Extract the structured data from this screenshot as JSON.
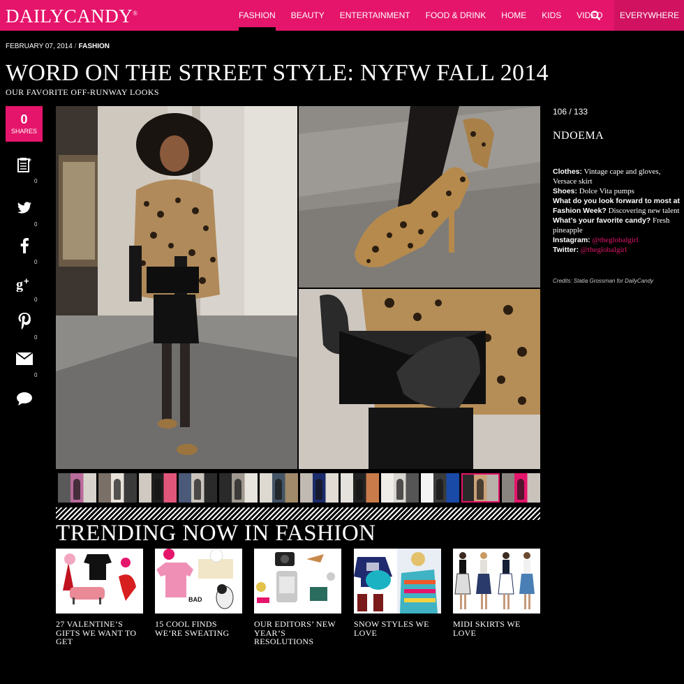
{
  "header": {
    "logo": "DAILYCANDY",
    "nav": [
      "FASHION",
      "BEAUTY",
      "ENTERTAINMENT",
      "FOOD & DRINK",
      "HOME",
      "KIDS",
      "VIDEO"
    ],
    "active_nav": "FASHION",
    "location": "EVERYWHERE",
    "icons": {
      "search": "search-icon",
      "location_toggle": "chevron-down-icon"
    }
  },
  "article": {
    "date": "FEBRUARY 07, 2014",
    "separator": "/",
    "category": "FASHION",
    "title": "WORD ON THE STREET STYLE: NYFW FALL 2014",
    "subtitle": "OUR FAVORITE OFF-RUNWAY LOOKS"
  },
  "share": {
    "count": "0",
    "label": "SHARES",
    "services": [
      {
        "icon": "notepad-icon",
        "count": "0"
      },
      {
        "icon": "twitter-icon",
        "count": "0"
      },
      {
        "icon": "facebook-icon",
        "count": "0"
      },
      {
        "icon": "google-plus-icon",
        "count": "0"
      },
      {
        "icon": "pinterest-icon",
        "count": "0"
      },
      {
        "icon": "email-icon",
        "count": "0"
      },
      {
        "icon": "comment-icon",
        "count": ""
      }
    ]
  },
  "slide": {
    "counter": "106 / 133",
    "name": "NDOEMA",
    "details": [
      {
        "label": "Clothes:",
        "value": " Vintage cape and gloves, Versace skirt"
      },
      {
        "label": "Shoes:",
        "value": " Dolce Vita pumps"
      },
      {
        "label": "What do you look forward to most at Fashion Week?",
        "value": " Discovering new talent"
      },
      {
        "label": "What’s your favorite candy?",
        "value": " Fresh pineapple"
      }
    ],
    "instagram_label": "Instagram:",
    "instagram": "@theglobalgirl",
    "twitter_label": "Twitter:",
    "twitter": "@theglobalgirl",
    "credits": "Credits: Statia Grossman for DailyCandy"
  },
  "thumbnails_selected_index": 10,
  "trending": {
    "title": "TRENDING NOW IN FASHION",
    "items": [
      "27 VALENTINE’S GIFTS WE WANT TO GET",
      "15 COOL FINDS WE’RE SWEATING",
      "OUR EDITORS’ NEW YEAR’S RESOLUTIONS",
      "SNOW STYLES WE LOVE",
      "MIDI SKIRTS WE LOVE"
    ]
  },
  "colors": {
    "brand": "#e5156b",
    "background": "#000000"
  }
}
